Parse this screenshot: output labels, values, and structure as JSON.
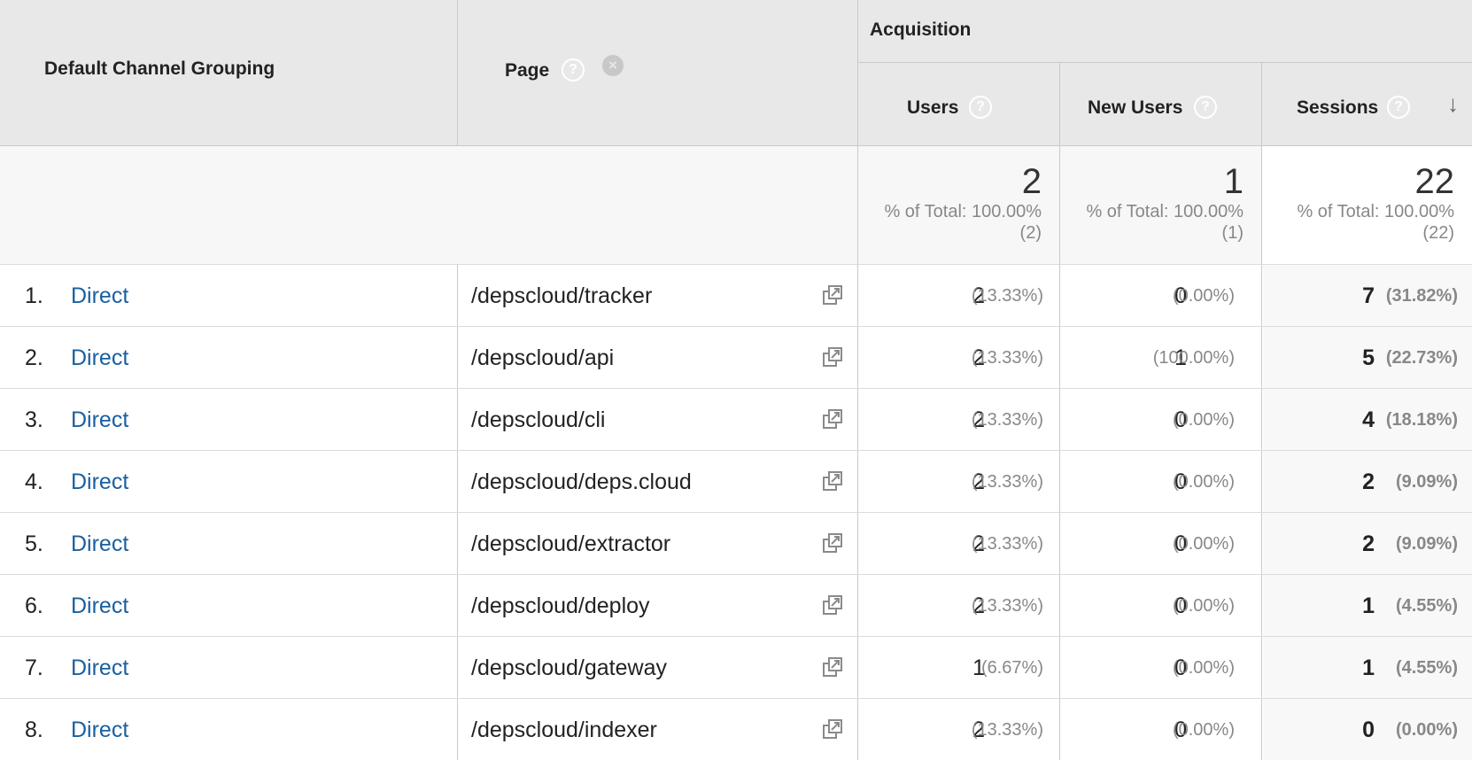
{
  "header": {
    "dimension1": "Default Channel Grouping",
    "dimension2": "Page",
    "group": "Acquisition",
    "columns": [
      "Users",
      "New Users",
      "Sessions"
    ],
    "help_glyph": "?",
    "remove_glyph": "×",
    "sort_glyph": "↓"
  },
  "totals": [
    {
      "value": "2",
      "pct": "% of Total: 100.00%",
      "abs": "(2)"
    },
    {
      "value": "1",
      "pct": "% of Total: 100.00%",
      "abs": "(1)"
    },
    {
      "value": "22",
      "pct": "% of Total: 100.00%",
      "abs": "(22)"
    }
  ],
  "rows": [
    {
      "n": "1.",
      "channel": "Direct",
      "page": "/depscloud/tracker",
      "users": "2",
      "users_pct": "(13.33%)",
      "new_users": "0",
      "new_users_pct": "(0.00%)",
      "sessions": "7",
      "sessions_pct": "(31.82%)"
    },
    {
      "n": "2.",
      "channel": "Direct",
      "page": "/depscloud/api",
      "users": "2",
      "users_pct": "(13.33%)",
      "new_users": "1",
      "new_users_pct": "(100.00%)",
      "sessions": "5",
      "sessions_pct": "(22.73%)"
    },
    {
      "n": "3.",
      "channel": "Direct",
      "page": "/depscloud/cli",
      "users": "2",
      "users_pct": "(13.33%)",
      "new_users": "0",
      "new_users_pct": "(0.00%)",
      "sessions": "4",
      "sessions_pct": "(18.18%)"
    },
    {
      "n": "4.",
      "channel": "Direct",
      "page": "/depscloud/deps.cloud",
      "users": "2",
      "users_pct": "(13.33%)",
      "new_users": "0",
      "new_users_pct": "(0.00%)",
      "sessions": "2",
      "sessions_pct": "(9.09%)"
    },
    {
      "n": "5.",
      "channel": "Direct",
      "page": "/depscloud/extractor",
      "users": "2",
      "users_pct": "(13.33%)",
      "new_users": "0",
      "new_users_pct": "(0.00%)",
      "sessions": "2",
      "sessions_pct": "(9.09%)"
    },
    {
      "n": "6.",
      "channel": "Direct",
      "page": "/depscloud/deploy",
      "users": "2",
      "users_pct": "(13.33%)",
      "new_users": "0",
      "new_users_pct": "(0.00%)",
      "sessions": "1",
      "sessions_pct": "(4.55%)"
    },
    {
      "n": "7.",
      "channel": "Direct",
      "page": "/depscloud/gateway",
      "users": "1",
      "users_pct": "(6.67%)",
      "new_users": "0",
      "new_users_pct": "(0.00%)",
      "sessions": "1",
      "sessions_pct": "(4.55%)"
    },
    {
      "n": "8.",
      "channel": "Direct",
      "page": "/depscloud/indexer",
      "users": "2",
      "users_pct": "(13.33%)",
      "new_users": "0",
      "new_users_pct": "(0.00%)",
      "sessions": "0",
      "sessions_pct": "(0.00%)"
    }
  ],
  "colors": {
    "link": "#1a5fa0",
    "header_bg": "#e8e8e8",
    "muted": "#888888"
  }
}
